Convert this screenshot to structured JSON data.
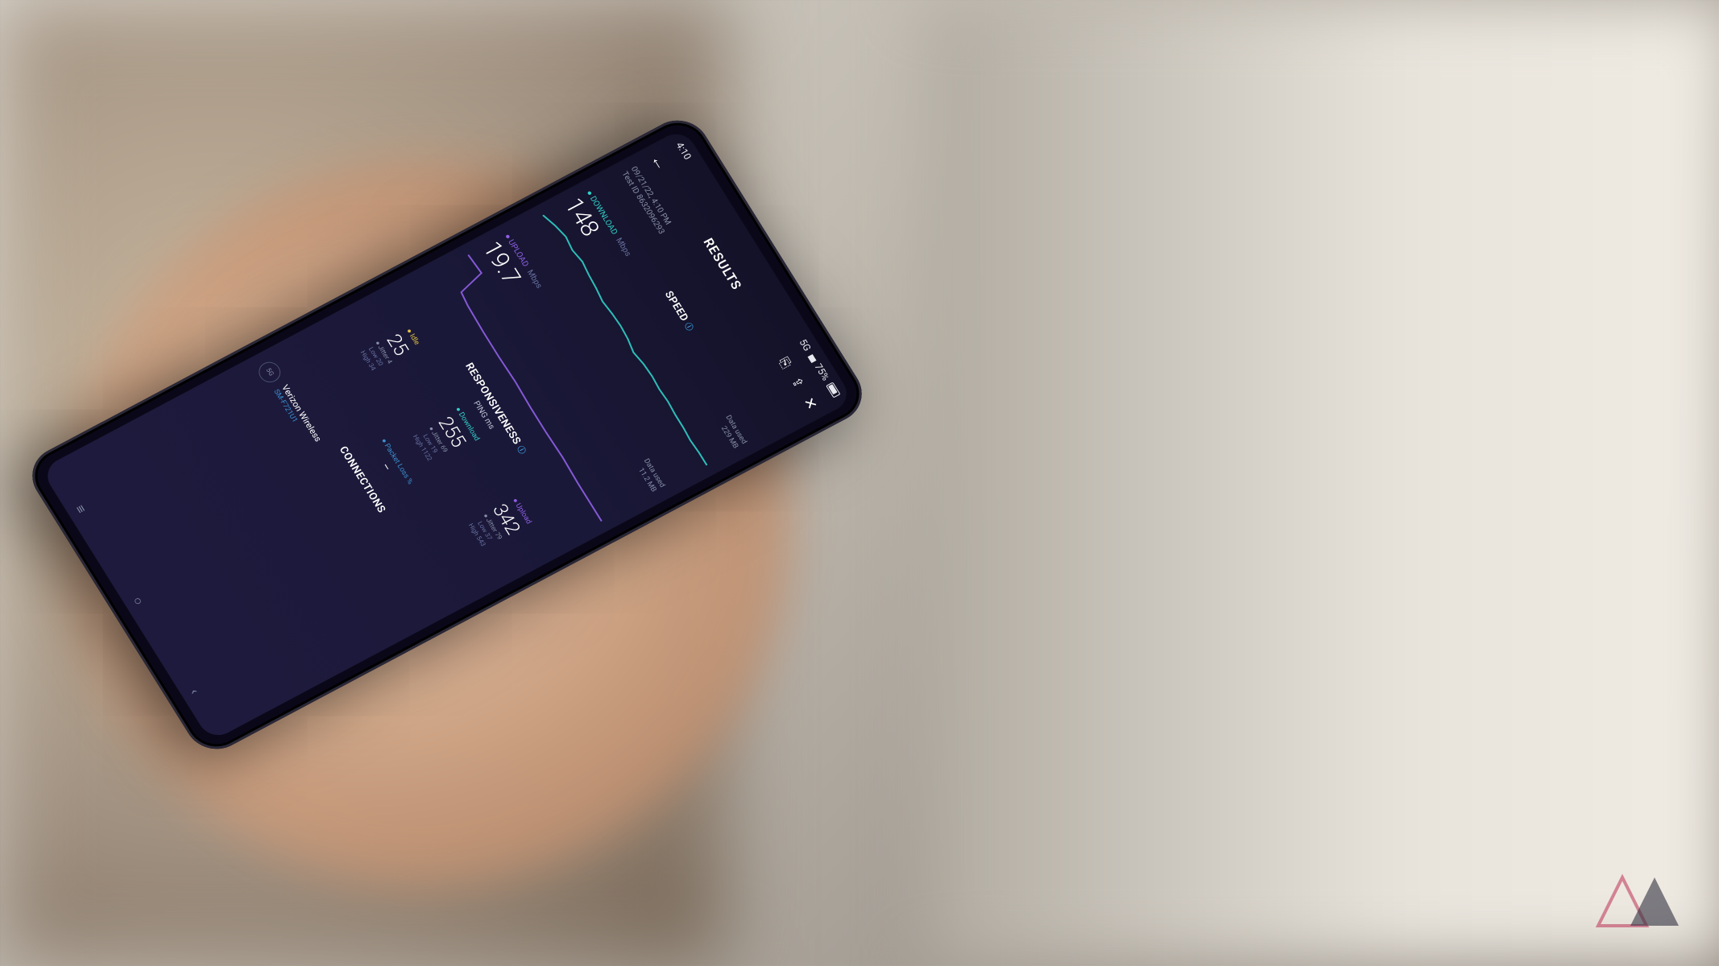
{
  "status_bar": {
    "time": "4:10",
    "network": "5G",
    "battery": "75%"
  },
  "header": {
    "title": "RESULTS"
  },
  "meta": {
    "datetime": "09/21/22, 4:10 PM",
    "test_id_label": "Test ID",
    "test_id": "8632096293"
  },
  "speed": {
    "title": "SPEED",
    "download": {
      "label": "DOWNLOAD",
      "value": "148",
      "unit": "Mbps",
      "data_used_label": "Data used",
      "data_used": "229 MB"
    },
    "upload": {
      "label": "UPLOAD",
      "value": "19.7",
      "unit": "Mbps",
      "data_used_label": "Data used",
      "data_used": "11.2 MB"
    }
  },
  "responsiveness": {
    "title": "RESPONSIVENESS",
    "ping_title": "PING ms",
    "idle": {
      "label": "Idle",
      "value": "25",
      "jitter_label": "Jitter",
      "jitter": "4",
      "low_label": "Low",
      "low": "20",
      "high_label": "High",
      "high": "34"
    },
    "download": {
      "label": "Download",
      "value": "255",
      "jitter_label": "Jitter",
      "jitter": "69",
      "low_label": "Low",
      "low": "19",
      "high_label": "High",
      "high": "1122"
    },
    "upload": {
      "label": "Upload",
      "value": "342",
      "jitter_label": "Jitter",
      "jitter": "79",
      "low_label": "Low",
      "low": "37",
      "high_label": "High",
      "high": "543"
    },
    "packet_loss": {
      "label": "Packet Loss",
      "unit": "%",
      "value": "–"
    }
  },
  "connections": {
    "title": "CONNECTIONS",
    "icon_label": "5G",
    "carrier": "Verizon Wireless",
    "device": "SM-F721U1"
  },
  "chart_data": {
    "type": "line",
    "series": [
      {
        "name": "download",
        "values": [
          120,
          140,
          150,
          148,
          152,
          150,
          148,
          146,
          148,
          150,
          148,
          145,
          148,
          150,
          148,
          150
        ]
      },
      {
        "name": "upload",
        "values": [
          20,
          19,
          20,
          19.5,
          19.7,
          20,
          19,
          19.7,
          20,
          19.5,
          19.7,
          19.8,
          19.7,
          20,
          19.5,
          19.7
        ]
      }
    ],
    "ylabel": "Mbps"
  }
}
